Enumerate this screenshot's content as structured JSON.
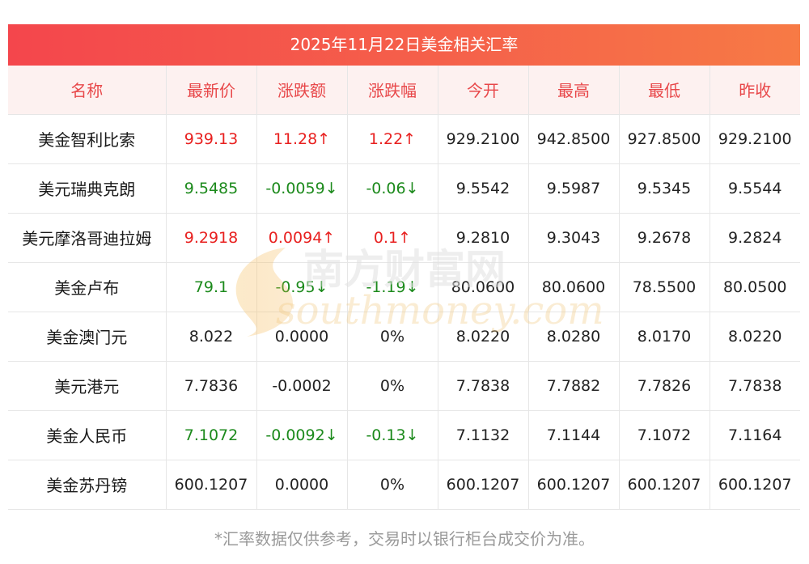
{
  "title": "2025年11月22日美金相关汇率",
  "headers": [
    "名称",
    "最新价",
    "涨跌额",
    "涨跌幅",
    "今开",
    "最高",
    "最低",
    "昨收"
  ],
  "rows": [
    {
      "name": "美金智利比索",
      "latest": "939.13",
      "change": "11.28↑",
      "pct": "1.22↑",
      "open": "929.2100",
      "high": "942.8500",
      "low": "927.8500",
      "prev": "929.2100",
      "trend": "up"
    },
    {
      "name": "美元瑞典克朗",
      "latest": "9.5485",
      "change": "-0.0059↓",
      "pct": "-0.06↓",
      "open": "9.5542",
      "high": "9.5987",
      "low": "9.5345",
      "prev": "9.5544",
      "trend": "down"
    },
    {
      "name": "美元摩洛哥迪拉姆",
      "latest": "9.2918",
      "change": "0.0094↑",
      "pct": "0.1↑",
      "open": "9.2810",
      "high": "9.3043",
      "low": "9.2678",
      "prev": "9.2824",
      "trend": "up"
    },
    {
      "name": "美金卢布",
      "latest": "79.1",
      "change": "-0.95↓",
      "pct": "-1.19↓",
      "open": "80.0600",
      "high": "80.0600",
      "low": "78.5500",
      "prev": "80.0500",
      "trend": "down"
    },
    {
      "name": "美金澳门元",
      "latest": "8.022",
      "change": "0.0000",
      "pct": "0%",
      "open": "8.0220",
      "high": "8.0280",
      "low": "8.0170",
      "prev": "8.0220",
      "trend": "flat"
    },
    {
      "name": "美元港元",
      "latest": "7.7836",
      "change": "-0.0002",
      "pct": "0%",
      "open": "7.7838",
      "high": "7.7882",
      "low": "7.7826",
      "prev": "7.7838",
      "trend": "flat"
    },
    {
      "name": "美金人民币",
      "latest": "7.1072",
      "change": "-0.0092↓",
      "pct": "-0.13↓",
      "open": "7.1132",
      "high": "7.1144",
      "low": "7.1072",
      "prev": "7.1164",
      "trend": "down"
    },
    {
      "name": "美金苏丹镑",
      "latest": "600.1207",
      "change": "0.0000",
      "pct": "0%",
      "open": "600.1207",
      "high": "600.1207",
      "low": "600.1207",
      "prev": "600.1207",
      "trend": "flat"
    }
  ],
  "watermark": {
    "cn": "南方财富网",
    "en": "southmoney.com"
  },
  "footnote": "*汇率数据仅供参考，交易时以银行柜台成交价为准。",
  "colors": {
    "accent": "#f4464c",
    "up": "#e8201f",
    "down": "#1c8a1c",
    "header_text": "#e8484a"
  }
}
